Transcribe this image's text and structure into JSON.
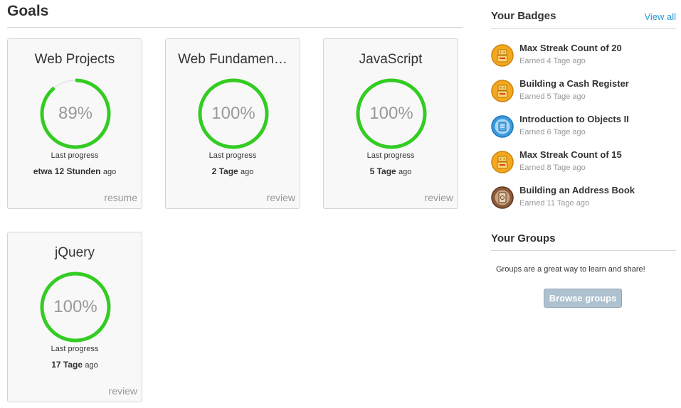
{
  "goals": {
    "title": "Goals",
    "last_progress_label": "Last progress",
    "ago_label": "ago",
    "ring_color": "#33cc22",
    "ring_track_color": "#e2e2e2",
    "cards": [
      {
        "title": "Web Projects",
        "percent": 89,
        "percent_label": "89%",
        "last_time": "etwa 12 Stunden",
        "action": "resume"
      },
      {
        "title": "Web Fundamen…",
        "percent": 100,
        "percent_label": "100%",
        "last_time": "2 Tage",
        "action": "review"
      },
      {
        "title": "JavaScript",
        "percent": 100,
        "percent_label": "100%",
        "last_time": "5 Tage",
        "action": "review"
      },
      {
        "title": "jQuery",
        "percent": 100,
        "percent_label": "100%",
        "last_time": "17 Tage",
        "action": "review"
      }
    ]
  },
  "sidebar": {
    "badges_title": "Your Badges",
    "view_all": "View all",
    "badges": [
      {
        "name": "Max Streak Count of 20",
        "earned": "Earned 4 Tage ago",
        "icon": "streak-robot-icon",
        "color": "#f5a81c"
      },
      {
        "name": "Building a Cash Register",
        "earned": "Earned 5 Tage ago",
        "icon": "cash-register-robot-icon",
        "color": "#f5a81c"
      },
      {
        "name": "Introduction to Objects II",
        "earned": "Earned 6 Tage ago",
        "icon": "objects-icon",
        "color": "#3a9be0"
      },
      {
        "name": "Max Streak Count of 15",
        "earned": "Earned 8 Tage ago",
        "icon": "streak-robot-icon",
        "color": "#f5a81c"
      },
      {
        "name": "Building an Address Book",
        "earned": "Earned 11 Tage ago",
        "icon": "address-book-icon",
        "color": "#8a5a3b"
      }
    ],
    "groups_title": "Your Groups",
    "groups_text": "Groups are a great way to learn and share!",
    "browse_groups": "Browse groups"
  }
}
